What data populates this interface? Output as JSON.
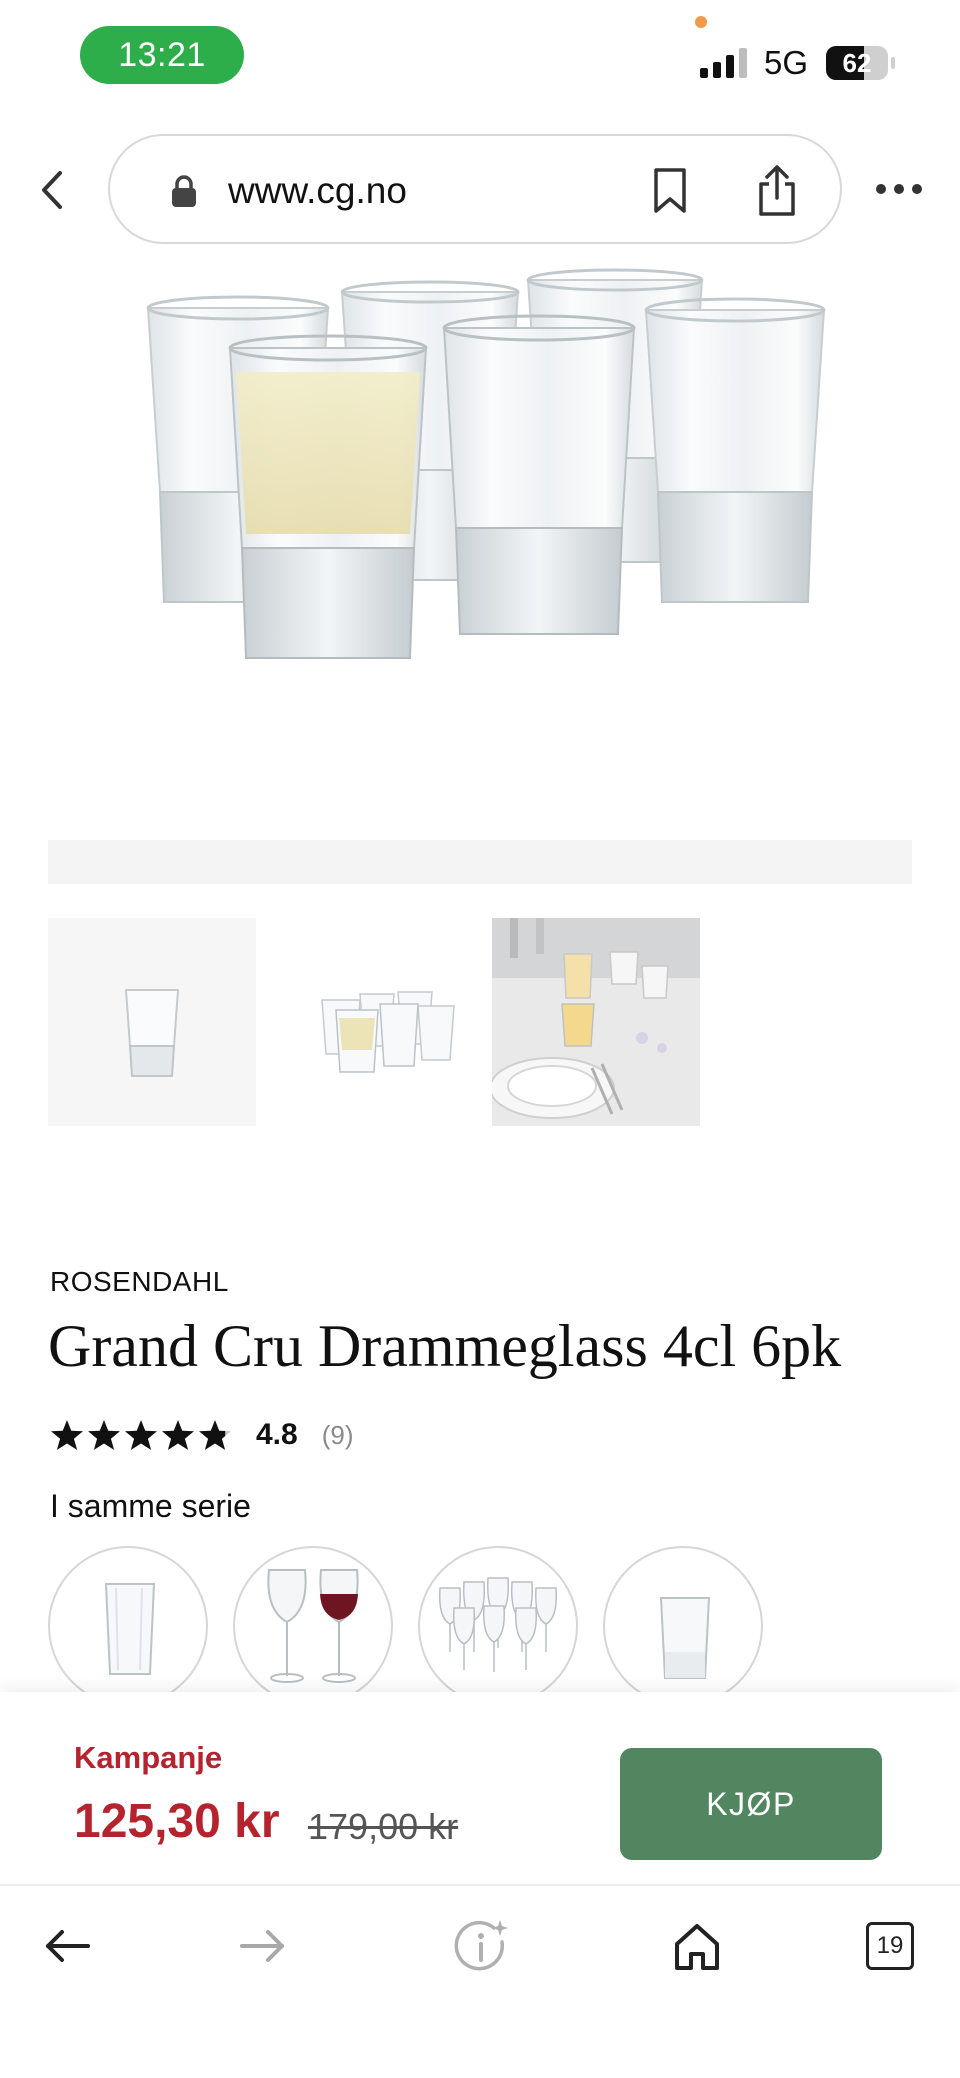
{
  "status_bar": {
    "time": "13:21",
    "network": "5G",
    "battery": "62",
    "battery_level": 0.62
  },
  "browser": {
    "url": "www.cg.no",
    "tab_count": "19"
  },
  "product": {
    "brand": "ROSENDAHL",
    "title": "Grand Cru Drammeglass 4cl 6pk",
    "rating": "4.8",
    "rating_count": "(9)",
    "rating_stars": 4.8,
    "series_label": "I samme serie"
  },
  "purchase": {
    "promo_label": "Kampanje",
    "price": "125,30 kr",
    "old_price": "179,00 kr",
    "buy_label": "KJØP"
  },
  "colors": {
    "accent_green": "#528660",
    "promo_red": "#b5232f",
    "status_green": "#2eae4b"
  },
  "icons": [
    "back-icon",
    "lock-icon",
    "bookmark-icon",
    "share-icon",
    "more-icon",
    "star-icon",
    "arrow-left-icon",
    "arrow-right-icon",
    "info-sparkle-icon",
    "home-icon",
    "tabs-icon"
  ]
}
